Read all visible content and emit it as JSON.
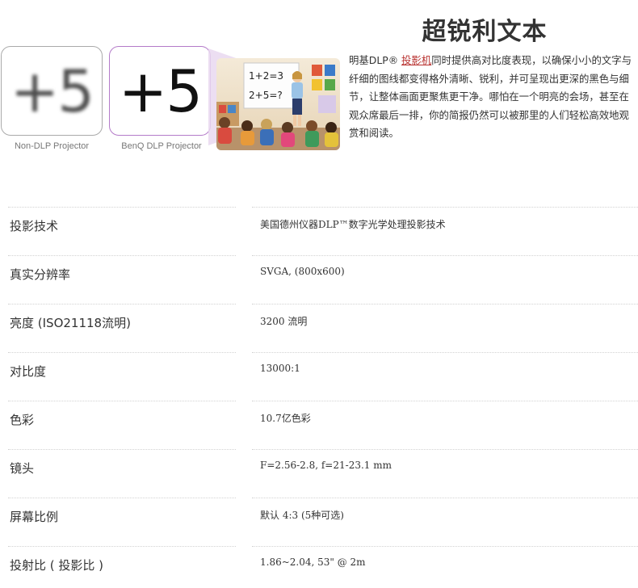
{
  "hero": {
    "title": "超锐利文本",
    "comparison": {
      "glyph_text": "+5",
      "non_dlp_caption": "Non-DLP Projector",
      "benq_caption": "BenQ DLP Projector"
    },
    "classroom_image": {
      "board_line_1": "1+2=3",
      "board_line_2": "2+5=?"
    },
    "description": {
      "prefix": "明基DLP® ",
      "link_text": "投影机",
      "body": "同时提供高对比度表现，以确保小小的文字与纤细的图线都变得格外清晰、锐利，并可呈现出更深的黑色与细节，让整体画面更聚焦更干净。哪怕在一个明亮的会场，甚至在观众席最后一排，你的简报仍然可以被那里的人们轻松高效地观赏和阅读。"
    }
  },
  "specs": [
    {
      "label": "投影技术",
      "value": "美国德州仪器DLP™数字光学处理投影技术"
    },
    {
      "label": "真实分辨率",
      "value": "SVGA, (800x600)"
    },
    {
      "label": "亮度 (ISO21118流明)",
      "value": "3200 流明"
    },
    {
      "label": "对比度",
      "value": "13000:1"
    },
    {
      "label": "色彩",
      "value": "10.7亿色彩"
    },
    {
      "label": "镜头",
      "value": "F=2.56-2.8, f=21-23.1 mm"
    },
    {
      "label": "屏幕比例",
      "value": "默认 4:3 (5种可选)"
    },
    {
      "label": "投射比 ( 投影比 )",
      "value": "1.86~2.04, 53\" @ 2m"
    }
  ],
  "colors": {
    "link": "#b8312f",
    "benq_border": "#b47bc9",
    "text": "#333333",
    "caption": "#777777"
  }
}
